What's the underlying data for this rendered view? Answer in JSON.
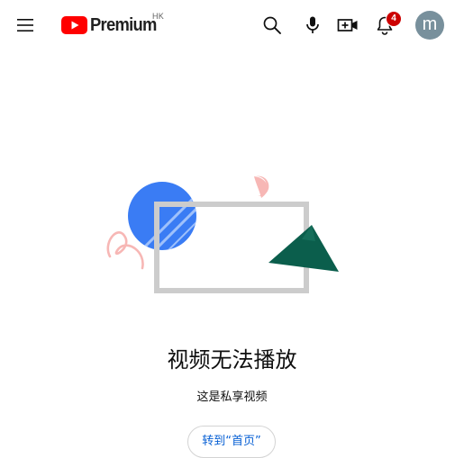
{
  "header": {
    "logo_text": "Premium",
    "country_code": "HK",
    "notification_count": "4",
    "avatar_letter": "m",
    "icons": {
      "menu": "hamburger-menu-icon",
      "search": "search-icon",
      "voice": "microphone-icon",
      "create": "create-video-icon",
      "notifications": "bell-icon"
    }
  },
  "error": {
    "title": "视频无法播放",
    "subtitle": "这是私享视频",
    "home_button_label": "转到“首页”"
  },
  "colors": {
    "brand_red": "#ff0000",
    "badge_red": "#cc0000",
    "avatar_bg": "#78909c",
    "link_blue": "#065fd4",
    "illustration_blue": "#3a7cf4",
    "illustration_green": "#0b5e4c",
    "illustration_pink": "#f7b7b5",
    "frame_gray": "#cccccc"
  }
}
